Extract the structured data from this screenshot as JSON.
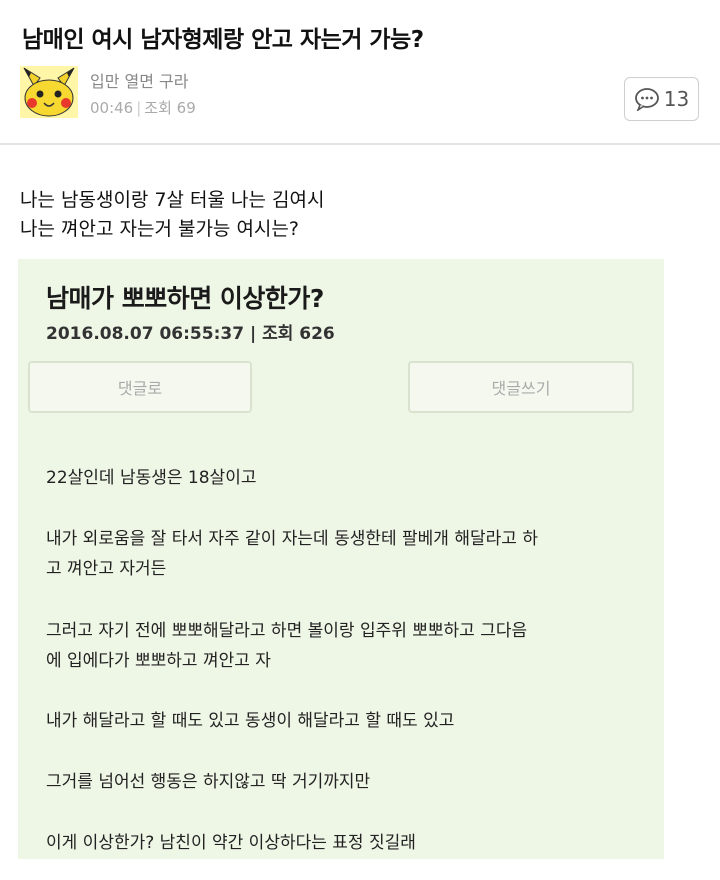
{
  "post": {
    "title": "남매인 여시 남자형제랑 안고 자는거 가능?",
    "author": "입만 열면 구라",
    "time": "00:46",
    "views_label": "조회 69",
    "comment_count": "13"
  },
  "body": {
    "lines": [
      "나는 남동생이랑 7살 터울 나는 김여시",
      "나는 껴안고 자는거 불가능 여시는?"
    ]
  },
  "embed": {
    "title": "남매가 뽀뽀하면 이상한가?",
    "meta": "2016.08.07 06:55:37 | 조회 626",
    "btn_list": "댓글로",
    "btn_write": "댓글쓰기",
    "paragraphs": [
      [
        "22살인데 남동생은 18살이고"
      ],
      [
        "내가 외로움을 잘 타서 자주 같이 자는데 동생한테 팔베개 해달라고 하",
        "고 껴안고 자거든"
      ],
      [
        "그러고 자기 전에 뽀뽀해달라고 하면 볼이랑 입주위 뽀뽀하고 그다음",
        "에 입에다가 뽀뽀하고 껴안고 자"
      ],
      [
        "내가 해달라고 할 때도 있고 동생이 해달라고 할 때도 있고"
      ],
      [
        "그거를 넘어선 행동은 하지않고 딱 거기까지만"
      ],
      [
        "이게 이상한가? 남친이 약간 이상하다는 표정 짓길래"
      ]
    ]
  },
  "icons": {
    "avatar": "pikachu-avatar",
    "comment": "speech-bubble-icon"
  }
}
